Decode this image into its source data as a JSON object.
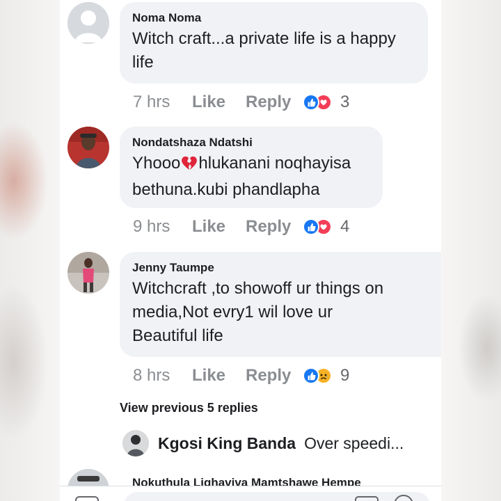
{
  "comments": [
    {
      "name": "Noma Noma",
      "text_lines": [
        "Witch craft...a private life is a happy",
        "life"
      ],
      "time": "7 hrs",
      "like_label": "Like",
      "reply_label": "Reply",
      "reactions": [
        "like",
        "love"
      ],
      "reaction_count": "3"
    },
    {
      "name": "Nondatshaza Ndatshi",
      "text_prefix": "Yhooo",
      "text_emoji": "broken-heart",
      "text_after": "hlukanani noqhayisa",
      "text_line2": "bethuna.kubi phandlapha",
      "time": "9 hrs",
      "like_label": "Like",
      "reply_label": "Reply",
      "reactions": [
        "like",
        "love"
      ],
      "reaction_count": "4"
    },
    {
      "name": "Jenny Taumpe",
      "text_lines": [
        "Witchcraft ,to showoff ur things on",
        "media,Not evry1 wil love ur",
        "Beautiful life"
      ],
      "time": "8 hrs",
      "like_label": "Like",
      "reply_label": "Reply",
      "reactions": [
        "like",
        "sad"
      ],
      "reaction_count": "9"
    }
  ],
  "view_previous": "View previous 5 replies",
  "reply_preview": {
    "name": "Kgosi King Banda",
    "text": "Over speedi..."
  },
  "next_comment_name": "Nokuthula Lighaviva Mamtshawe Hempe",
  "colors": {
    "bubble": "#f0f2f5",
    "like_blue": "#1877f2",
    "love_red": "#f33e58",
    "sad_yellow": "#f7b125",
    "meta_gray": "#8a8d91"
  }
}
